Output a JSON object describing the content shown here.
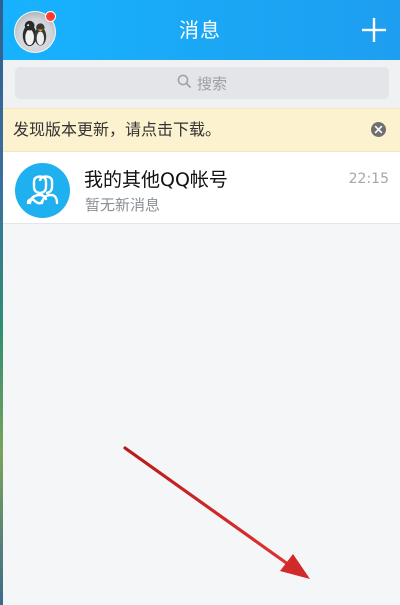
{
  "header": {
    "title": "消息",
    "avatar_icon": "penguin-avatar-icon",
    "plus_icon": "plus-icon",
    "unread_dot_color": "#ff3b30"
  },
  "search": {
    "placeholder": "搜索",
    "icon": "search-icon"
  },
  "banner": {
    "text": "发现版本更新，请点击下载。",
    "close_icon": "close-circle-icon"
  },
  "conversations": [
    {
      "title": "我的其他QQ帐号",
      "subtitle": "暂无新消息",
      "time": "22:15",
      "icon": "qq-accounts-icon"
    }
  ],
  "colors": {
    "header_blue": "#1aa9f6",
    "banner_bg": "#fdf2cf",
    "accent_blue": "#1eb0ef",
    "arrow_red": "#d12a2a"
  }
}
